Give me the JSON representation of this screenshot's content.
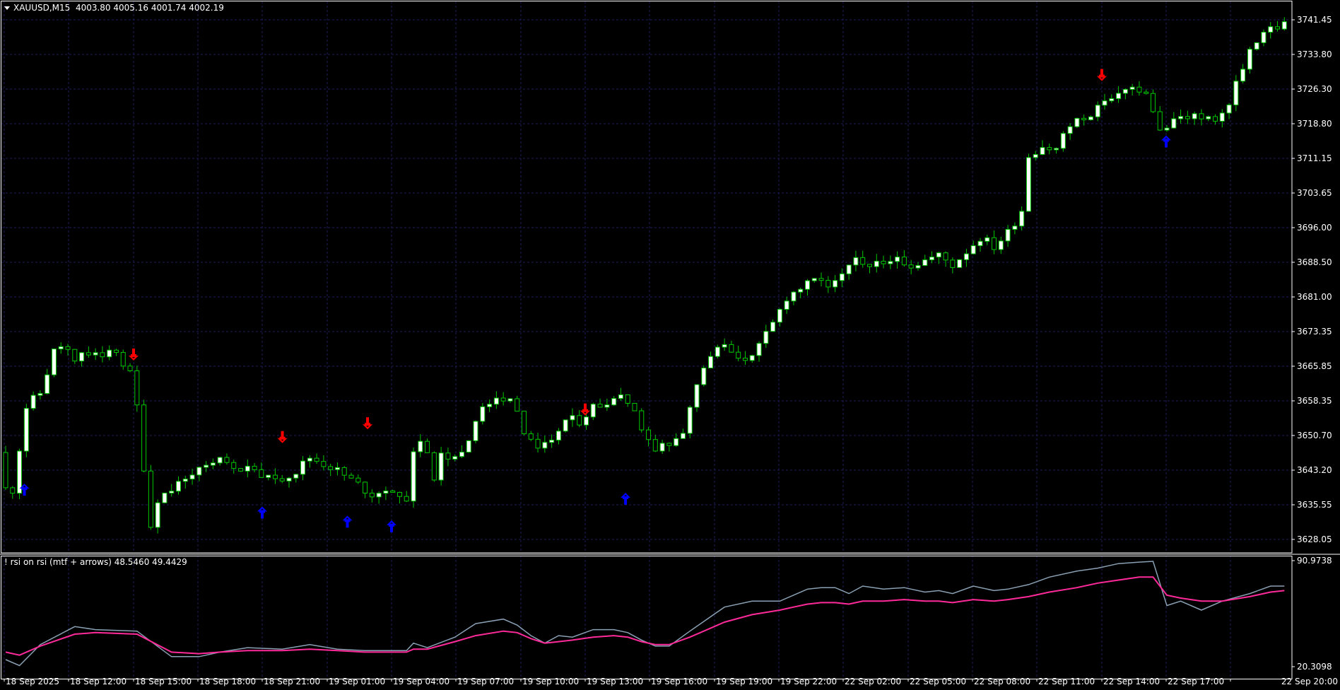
{
  "symbol_header": {
    "symbol_tf": "XAUUSD,M15",
    "ohlc": "4003.80 4005.16 4001.74 4002.19"
  },
  "indicator_header": {
    "name": "! rsi on rsi (mtf + arrows)",
    "values": "48.5460 49.4429"
  },
  "price_axis": {
    "labels": [
      "3741.45",
      "3733.80",
      "3726.30",
      "3718.80",
      "3711.15",
      "3703.65",
      "3696.00",
      "3688.50",
      "3681.00",
      "3673.35",
      "3665.85",
      "3658.35",
      "3650.70",
      "3643.20",
      "3635.55",
      "3628.05"
    ]
  },
  "indicator_axis": {
    "top": "90.9738",
    "bottom": "20.3098"
  },
  "time_axis": {
    "labels": [
      "18 Sep 2025",
      "18 Sep 12:00",
      "18 Sep 15:00",
      "18 Sep 18:00",
      "18 Sep 21:00",
      "19 Sep 01:00",
      "19 Sep 04:00",
      "19 Sep 07:00",
      "19 Sep 10:00",
      "19 Sep 13:00",
      "19 Sep 16:00",
      "19 Sep 19:00",
      "19 Sep 22:00",
      "22 Sep 02:00",
      "22 Sep 05:00",
      "22 Sep 08:00",
      "22 Sep 11:00",
      "22 Sep 14:00",
      "22 Sep 17:00",
      "22 Sep 20:00"
    ]
  },
  "colors": {
    "background": "#000000",
    "grid": "#1e1e5a",
    "bull_candle": "#ffffff",
    "bear_candle": "#000000",
    "candle_outline": "#00c800",
    "buy_arrow": "#0000ff",
    "sell_arrow": "#ff0000",
    "rsi_line": "#8aa0b4",
    "signal_line": "#ff2a9a",
    "axis_text": "#ffffff"
  },
  "chart_data": {
    "type": "candlestick",
    "timeframe": "M15",
    "price_range": [
      3626,
      3744
    ],
    "price_path": [
      [
        0,
        3646
      ],
      [
        0.5,
        3639
      ],
      [
        2,
        3639
      ],
      [
        4,
        3657
      ],
      [
        6,
        3660
      ],
      [
        8,
        3669
      ],
      [
        9,
        3670
      ],
      [
        11,
        3668
      ],
      [
        14,
        3668
      ],
      [
        17,
        3669
      ],
      [
        19,
        3664
      ],
      [
        20,
        3657
      ],
      [
        22,
        3631
      ],
      [
        23,
        3637
      ],
      [
        25,
        3639
      ],
      [
        28,
        3643
      ],
      [
        32,
        3645
      ],
      [
        36,
        3643
      ],
      [
        40,
        3641
      ],
      [
        43,
        3643
      ],
      [
        45,
        3646
      ],
      [
        48,
        3644
      ],
      [
        51,
        3641
      ],
      [
        54,
        3638
      ],
      [
        57,
        3639
      ],
      [
        59,
        3637
      ],
      [
        60,
        3647
      ],
      [
        61,
        3649
      ],
      [
        62,
        3648
      ],
      [
        63,
        3640
      ],
      [
        64,
        3646
      ],
      [
        66,
        3646
      ],
      [
        68,
        3650
      ],
      [
        70,
        3657
      ],
      [
        72,
        3659
      ],
      [
        74,
        3658
      ],
      [
        76,
        3652
      ],
      [
        78,
        3648
      ],
      [
        80,
        3650
      ],
      [
        82,
        3654
      ],
      [
        84,
        3654
      ],
      [
        86,
        3657
      ],
      [
        88,
        3658
      ],
      [
        90,
        3659
      ],
      [
        92,
        3656
      ],
      [
        94,
        3650
      ],
      [
        95,
        3648
      ],
      [
        97,
        3649
      ],
      [
        99,
        3651
      ],
      [
        101,
        3661
      ],
      [
        103,
        3668
      ],
      [
        105,
        3670
      ],
      [
        108,
        3668
      ],
      [
        110,
        3670
      ],
      [
        112,
        3675
      ],
      [
        114,
        3681
      ],
      [
        116,
        3683
      ],
      [
        118,
        3684
      ],
      [
        120,
        3684
      ],
      [
        122,
        3687
      ],
      [
        124,
        3689
      ],
      [
        126,
        3688
      ],
      [
        128,
        3688
      ],
      [
        130,
        3690
      ],
      [
        132,
        3688
      ],
      [
        134,
        3689
      ],
      [
        136,
        3690
      ],
      [
        138,
        3688
      ],
      [
        140,
        3691
      ],
      [
        142,
        3694
      ],
      [
        144,
        3692
      ],
      [
        146,
        3695
      ],
      [
        148,
        3700
      ],
      [
        149,
        3712
      ],
      [
        151,
        3714
      ],
      [
        153,
        3714
      ],
      [
        155,
        3718
      ],
      [
        157,
        3720
      ],
      [
        160,
        3723
      ],
      [
        162,
        3725
      ],
      [
        164,
        3726
      ],
      [
        166,
        3725
      ],
      [
        167,
        3722
      ],
      [
        168,
        3717
      ],
      [
        170,
        3719
      ],
      [
        172,
        3721
      ],
      [
        175,
        3720
      ],
      [
        176,
        3720
      ],
      [
        178,
        3723
      ],
      [
        180,
        3731
      ],
      [
        182,
        3737
      ],
      [
        184,
        3740
      ],
      [
        185,
        3740.5
      ]
    ],
    "sell_signals": [
      {
        "time": "18 Sep 15:00",
        "price": 3666
      },
      {
        "time": "18 Sep 22:00",
        "price": 3648
      },
      {
        "time": "19 Sep 03:00",
        "price": 3651
      },
      {
        "time": "19 Sep 13:00",
        "price": 3654
      },
      {
        "time": "22 Sep 14:00",
        "price": 3727
      }
    ],
    "buy_signals": [
      {
        "time": "18 Sep 10:00",
        "price": 3641
      },
      {
        "time": "18 Sep 21:00",
        "price": 3636
      },
      {
        "time": "19 Sep 02:00",
        "price": 3634
      },
      {
        "time": "19 Sep 04:00",
        "price": 3633
      },
      {
        "time": "19 Sep 15:00",
        "price": 3639
      },
      {
        "time": "22 Sep 17:00",
        "price": 3717
      }
    ],
    "indicator": {
      "name": "! rsi on rsi (mtf + arrows)",
      "range": [
        20.3098,
        90.9738
      ],
      "series": [
        {
          "name": "rsi",
          "points": [
            [
              0,
              25
            ],
            [
              2,
              21
            ],
            [
              5,
              35
            ],
            [
              10,
              47
            ],
            [
              13,
              45
            ],
            [
              19,
              44
            ],
            [
              24,
              27
            ],
            [
              28,
              27
            ],
            [
              31,
              30
            ],
            [
              35,
              33
            ],
            [
              40,
              32
            ],
            [
              44,
              35
            ],
            [
              48,
              32
            ],
            [
              52,
              31
            ],
            [
              56,
              31
            ],
            [
              58,
              31
            ],
            [
              59,
              36
            ],
            [
              61,
              33
            ],
            [
              65,
              40
            ],
            [
              68,
              49
            ],
            [
              72,
              52
            ],
            [
              74,
              48
            ],
            [
              76,
              41
            ],
            [
              78,
              36
            ],
            [
              80,
              41
            ],
            [
              82,
              40
            ],
            [
              85,
              45
            ],
            [
              88,
              45
            ],
            [
              90,
              43
            ],
            [
              92,
              38
            ],
            [
              94,
              34
            ],
            [
              96,
              34
            ],
            [
              99,
              44
            ],
            [
              104,
              60
            ],
            [
              108,
              64
            ],
            [
              112,
              64
            ],
            [
              114,
              68
            ],
            [
              116,
              72
            ],
            [
              118,
              73
            ],
            [
              120,
              73
            ],
            [
              122,
              69
            ],
            [
              124,
              74
            ],
            [
              127,
              72
            ],
            [
              130,
              73
            ],
            [
              133,
              70
            ],
            [
              135,
              71
            ],
            [
              137,
              69
            ],
            [
              140,
              74
            ],
            [
              143,
              71
            ],
            [
              145,
              72
            ],
            [
              148,
              75
            ],
            [
              151,
              80
            ],
            [
              155,
              84
            ],
            [
              158,
              86
            ],
            [
              161,
              89
            ],
            [
              164,
              90
            ],
            [
              166,
              90.5
            ],
            [
              168,
              61
            ],
            [
              170,
              64
            ],
            [
              173,
              58
            ],
            [
              176,
              64
            ],
            [
              180,
              69
            ],
            [
              183,
              74
            ],
            [
              185,
              74
            ]
          ]
        },
        {
          "name": "signal",
          "points": [
            [
              0,
              30
            ],
            [
              2,
              28
            ],
            [
              5,
              34
            ],
            [
              10,
              42
            ],
            [
              13,
              43
            ],
            [
              19,
              42
            ],
            [
              24,
              30
            ],
            [
              28,
              29
            ],
            [
              31,
              30
            ],
            [
              35,
              31
            ],
            [
              40,
              31
            ],
            [
              44,
              32
            ],
            [
              48,
              31
            ],
            [
              52,
              30
            ],
            [
              56,
              30
            ],
            [
              58,
              30
            ],
            [
              59,
              32
            ],
            [
              61,
              32
            ],
            [
              65,
              37
            ],
            [
              68,
              41
            ],
            [
              72,
              44
            ],
            [
              74,
              43
            ],
            [
              76,
              39
            ],
            [
              78,
              36
            ],
            [
              80,
              37
            ],
            [
              82,
              38
            ],
            [
              85,
              40
            ],
            [
              88,
              41
            ],
            [
              90,
              40
            ],
            [
              92,
              37
            ],
            [
              94,
              35
            ],
            [
              96,
              35
            ],
            [
              99,
              40
            ],
            [
              104,
              50
            ],
            [
              108,
              55
            ],
            [
              112,
              58
            ],
            [
              114,
              60
            ],
            [
              116,
              62
            ],
            [
              118,
              63
            ],
            [
              120,
              63
            ],
            [
              122,
              62
            ],
            [
              124,
              64
            ],
            [
              127,
              64
            ],
            [
              130,
              65
            ],
            [
              133,
              64
            ],
            [
              135,
              64
            ],
            [
              137,
              63
            ],
            [
              140,
              65
            ],
            [
              143,
              64
            ],
            [
              145,
              65
            ],
            [
              148,
              67
            ],
            [
              151,
              70
            ],
            [
              155,
              73
            ],
            [
              158,
              76
            ],
            [
              161,
              78
            ],
            [
              164,
              80
            ],
            [
              166,
              80
            ],
            [
              168,
              68
            ],
            [
              170,
              66
            ],
            [
              173,
              64
            ],
            [
              176,
              64
            ],
            [
              180,
              67
            ],
            [
              183,
              70
            ],
            [
              185,
              71
            ]
          ]
        }
      ]
    }
  }
}
